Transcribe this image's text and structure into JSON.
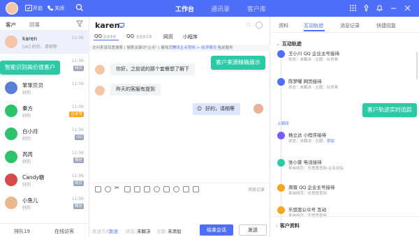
{
  "topbar": {
    "status_online": "开启",
    "status_offline": "关闭",
    "nav": [
      "工作台",
      "通讯录",
      "客户库"
    ],
    "colors": {
      "brand": "#4f6ef7"
    }
  },
  "left": {
    "tabs": [
      "客户",
      "同事"
    ],
    "items": [
      {
        "name": "karen",
        "sub": "[ok] 好的，请稍等",
        "time": "11:06",
        "badge": "",
        "badge_color": "",
        "avatar_color": "#f3c6a8"
      },
      {
        "name": "",
        "sub": "",
        "time": "11:06",
        "badge": "网页",
        "badge_color": "#9aa6b8",
        "avatar_color": "#ffffff"
      },
      {
        "name": "笨笨贝贝",
        "sub": "好的",
        "time": "11:06",
        "badge": "",
        "badge_color": "",
        "avatar_color": "#5b7fd6"
      },
      {
        "name": "秦方",
        "sub": "好的",
        "time": "11:06",
        "badge": "企业号",
        "badge_color": "#f5a623",
        "avatar_color": "#2ec26a"
      },
      {
        "name": "白小月",
        "sub": "好的",
        "time": "11:06",
        "badge": "QQ",
        "badge_color": "#9aa6b8",
        "avatar_color": "#2ec26a"
      },
      {
        "name": "芮芮",
        "sub": "好的",
        "time": "11:06",
        "badge": "微信",
        "badge_color": "#9aa6b8",
        "avatar_color": "#2ec26a"
      },
      {
        "name": "Candy糖",
        "sub": "好的",
        "time": "11:06",
        "badge": "网页",
        "badge_color": "#9aa6b8",
        "avatar_color": "#d94a4a"
      },
      {
        "name": "小鱼儿",
        "sub": "好的",
        "time": "11:06",
        "badge": "微信",
        "badge_color": "#9aa6b8",
        "avatar_color": "#e8b98f"
      },
      {
        "name": "乐高谈",
        "sub": "好的",
        "time": "11:06",
        "badge": "QQ",
        "badge_color": "#9aa6b8",
        "avatar_color": "#4a6fd0"
      }
    ],
    "bottom_queue": "排队19",
    "bottom_online": "在线访客"
  },
  "callouts": {
    "left": "智能识别高价值客户",
    "middle": "客户来源精确展示",
    "right": "客户轨迹实时追踪",
    "color": "#2cc9a6"
  },
  "chat": {
    "name": "karen",
    "channels": [
      {
        "label": "QQ",
        "sub": "企业主号"
      },
      {
        "label": "QQ",
        "sub": "企业主工号"
      },
      {
        "label": "网页",
        "sub": ""
      },
      {
        "label": "小程序",
        "sub": ""
      }
    ],
    "path_prefix": "访问来源百度搜索 | 搜索关键词\"企点\" | 着陆页",
    "path_highlight": "腾讯企点官网 > 经济情况",
    "path_suffix": " 售前服务",
    "messages": [
      {
        "dir": "in",
        "text": "你好，之前说的那个套餐想了解下"
      },
      {
        "dir": "in",
        "text": "昨天的客服有提到"
      },
      {
        "dir": "out",
        "text": "好的，请稍等"
      }
    ],
    "history": "消息记录",
    "footer": {
      "send_method_label": "发送方式",
      "send_method": "发送",
      "state_label": "状态",
      "state": "未解决",
      "topic_label": "主题",
      "topic": "未添加",
      "end_button": "结束会话",
      "send_button": "发送"
    }
  },
  "right": {
    "tabs": [
      "资料",
      "互动轨迹",
      "消息记录",
      "快捷回复"
    ],
    "section_title": "互动轨迹",
    "date": "上周四",
    "events": [
      {
        "title": "王小川  QQ 企业主号接待",
        "sub": "状态：未解决 · 主题：业务券",
        "add": "",
        "color": "#4f6ef7"
      },
      {
        "title": "陈梦曜  网页接待",
        "sub": "状态：未解决 · 主题：业务券",
        "add": "",
        "color": "#4f6ef7"
      },
      {
        "title": "杨立达  小程序接待",
        "sub": "状态：未解决 · 主题：",
        "add": "添加",
        "color": "#7a5af8"
      },
      {
        "title": "张小萱  电话接待",
        "sub": "来自网页：乐悠悠官网-企业论坛",
        "add": "",
        "color": "#2cc9a6"
      },
      {
        "title": "周晋  QQ 企业主号接待",
        "sub": "来自网页：乐悠悠官网",
        "add": "",
        "color": "#f5a623"
      },
      {
        "title": "乐悠悠公众号  互动",
        "sub": "来自网页：乐悠悠官网",
        "add": "",
        "color": "#f5a623"
      }
    ],
    "footer_section": "客户资料"
  }
}
